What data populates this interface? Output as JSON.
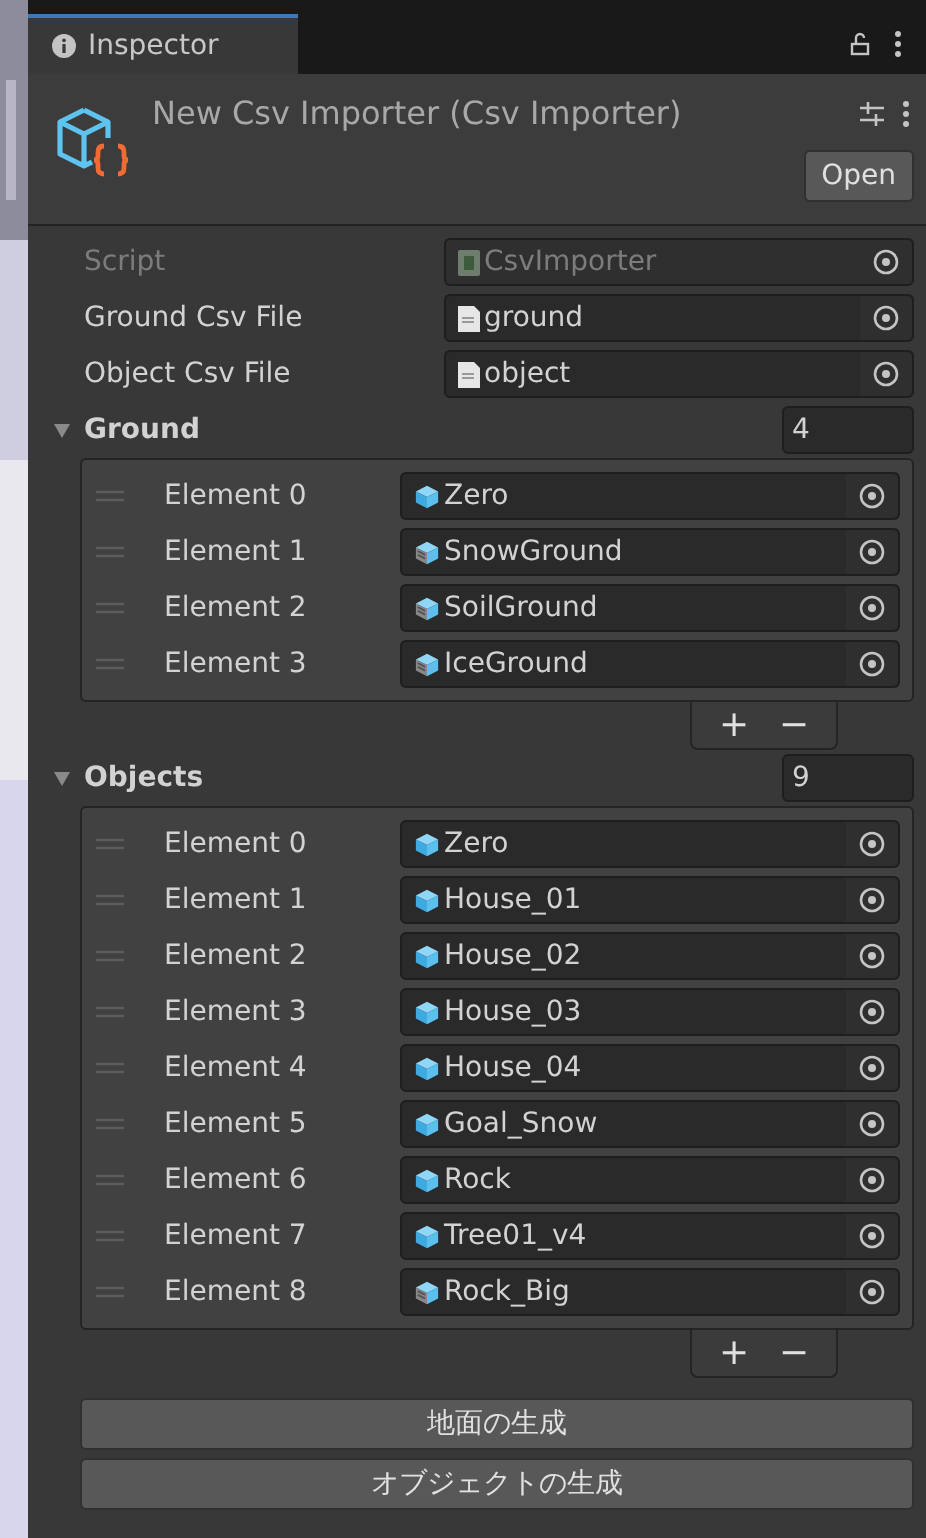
{
  "tab": {
    "label": "Inspector",
    "selected": true
  },
  "header": {
    "title": "New Csv Importer (Csv Importer)",
    "open_button": "Open"
  },
  "fields": [
    {
      "label": "Script",
      "value": "CsvImporter",
      "kind": "script",
      "disabled": true
    },
    {
      "label": "Ground Csv File",
      "value": "ground",
      "kind": "text",
      "disabled": false
    },
    {
      "label": "Object Csv File",
      "value": "object",
      "kind": "text",
      "disabled": false
    }
  ],
  "lists": [
    {
      "label": "Ground",
      "expanded": true,
      "count": "4",
      "add": "+",
      "remove": "−",
      "items": [
        {
          "label": "Element 0",
          "value": "Zero",
          "kind": "prefab"
        },
        {
          "label": "Element 1",
          "value": "SnowGround",
          "kind": "model"
        },
        {
          "label": "Element 2",
          "value": "SoilGround",
          "kind": "model"
        },
        {
          "label": "Element 3",
          "value": "IceGround",
          "kind": "model"
        }
      ]
    },
    {
      "label": "Objects",
      "expanded": true,
      "count": "9",
      "add": "+",
      "remove": "−",
      "items": [
        {
          "label": "Element 0",
          "value": "Zero",
          "kind": "prefab"
        },
        {
          "label": "Element 1",
          "value": "House_01",
          "kind": "prefab"
        },
        {
          "label": "Element 2",
          "value": "House_02",
          "kind": "prefab"
        },
        {
          "label": "Element 3",
          "value": "House_03",
          "kind": "prefab"
        },
        {
          "label": "Element 4",
          "value": "House_04",
          "kind": "prefab"
        },
        {
          "label": "Element 5",
          "value": "Goal_Snow",
          "kind": "prefab"
        },
        {
          "label": "Element 6",
          "value": "Rock",
          "kind": "prefab"
        },
        {
          "label": "Element 7",
          "value": "Tree01_v4",
          "kind": "prefab"
        },
        {
          "label": "Element 8",
          "value": "Rock_Big",
          "kind": "model"
        }
      ]
    }
  ],
  "buttons": [
    "地面の生成",
    "オブジェクトの生成"
  ]
}
